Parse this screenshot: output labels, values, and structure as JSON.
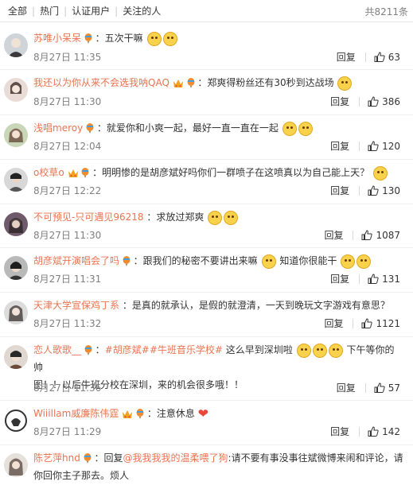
{
  "tabs": [
    "全部",
    "热门",
    "认证用户",
    "关注的人"
  ],
  "total": "共8211条",
  "reply_label": "回复",
  "comments": [
    {
      "user": "苏唯小呆呆",
      "text": "：五次干嘛",
      "time": "8月27日 11:35",
      "likes": "63"
    },
    {
      "user": "我还以为你从来不会选我呐QAQ",
      "text": "：郑爽得粉丝还有30秒到达战场",
      "time": "8月27日 11:30",
      "likes": "386"
    },
    {
      "user": "浅唱meroy",
      "text": "：就爱你和小爽一起，最好一直一直在一起",
      "time": "8月27日 12:04",
      "likes": "120"
    },
    {
      "user": "o校草o",
      "text": "：明明惨的是胡彦斌好吗你们一群喷子在这喷真以为自己能上天？",
      "time": "8月27日 12:22",
      "likes": "130"
    },
    {
      "user": "不可预见-只可遇见96218",
      "text": "：求放过郑爽",
      "time": "8月27日 11:30",
      "likes": "1087"
    },
    {
      "user": "胡彦斌开演唱会了吗",
      "text": "：跟我们的秘密不要讲出来嘛",
      "text2": "知道你很能干",
      "time": "8月27日 11:31",
      "likes": "131"
    },
    {
      "user": "天津大学宣保鸡丁系",
      "text": "：是真的就承认，是假的就澄清，一天到晚玩文字游戏有意思？",
      "time": "8月27日 11:32",
      "likes": "1121"
    },
    {
      "user": "恋人歌歌__",
      "tag1": "#胡彦斌#",
      "tag2": "#牛班音乐学校#",
      "text": " 这么早到深圳啦",
      "text2": "下午等你的帅",
      "text3": "图！！以后牛班分校在深圳，来的机会很多哦！！",
      "time": "8月27日 11:36",
      "likes": "57"
    },
    {
      "user": "Wiiillam威廉陈伟霆",
      "text": "：注意休息",
      "time": "8月27日 11:29",
      "likes": "142"
    },
    {
      "user": "陈艺萍hnd",
      "text": "：回复",
      "mention": "@我我我我的温柔喂了狗",
      "text2": ":请不要有事没事往斌微博来闹和评论，请",
      "text3": "你回你主子那去。烦人"
    }
  ],
  "colors": {
    "username": "#eb7350",
    "meta": "#808080",
    "divider": "#eeeeee"
  },
  "icons": {
    "like": "thumb-up-icon",
    "vip": "crown-icon",
    "badge": "balloon-icon",
    "emoji": "face-emoji-icon"
  }
}
